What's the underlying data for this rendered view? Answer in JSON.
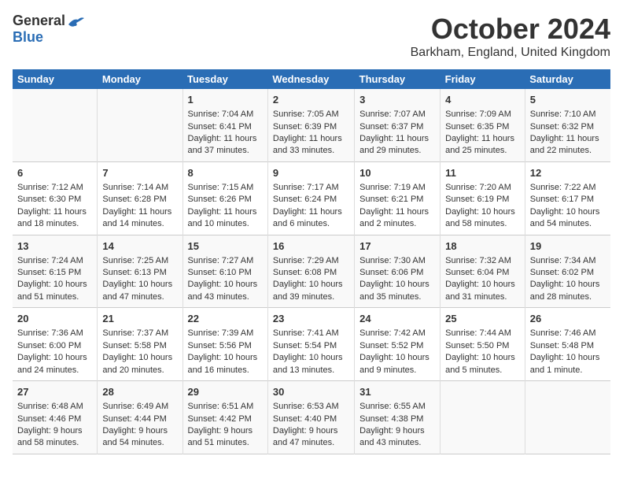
{
  "logo": {
    "general": "General",
    "blue": "Blue"
  },
  "title": {
    "month": "October 2024",
    "location": "Barkham, England, United Kingdom"
  },
  "days_of_week": [
    "Sunday",
    "Monday",
    "Tuesday",
    "Wednesday",
    "Thursday",
    "Friday",
    "Saturday"
  ],
  "weeks": [
    [
      {
        "day": "",
        "content": ""
      },
      {
        "day": "",
        "content": ""
      },
      {
        "day": "1",
        "content": "Sunrise: 7:04 AM\nSunset: 6:41 PM\nDaylight: 11 hours and 37 minutes."
      },
      {
        "day": "2",
        "content": "Sunrise: 7:05 AM\nSunset: 6:39 PM\nDaylight: 11 hours and 33 minutes."
      },
      {
        "day": "3",
        "content": "Sunrise: 7:07 AM\nSunset: 6:37 PM\nDaylight: 11 hours and 29 minutes."
      },
      {
        "day": "4",
        "content": "Sunrise: 7:09 AM\nSunset: 6:35 PM\nDaylight: 11 hours and 25 minutes."
      },
      {
        "day": "5",
        "content": "Sunrise: 7:10 AM\nSunset: 6:32 PM\nDaylight: 11 hours and 22 minutes."
      }
    ],
    [
      {
        "day": "6",
        "content": "Sunrise: 7:12 AM\nSunset: 6:30 PM\nDaylight: 11 hours and 18 minutes."
      },
      {
        "day": "7",
        "content": "Sunrise: 7:14 AM\nSunset: 6:28 PM\nDaylight: 11 hours and 14 minutes."
      },
      {
        "day": "8",
        "content": "Sunrise: 7:15 AM\nSunset: 6:26 PM\nDaylight: 11 hours and 10 minutes."
      },
      {
        "day": "9",
        "content": "Sunrise: 7:17 AM\nSunset: 6:24 PM\nDaylight: 11 hours and 6 minutes."
      },
      {
        "day": "10",
        "content": "Sunrise: 7:19 AM\nSunset: 6:21 PM\nDaylight: 11 hours and 2 minutes."
      },
      {
        "day": "11",
        "content": "Sunrise: 7:20 AM\nSunset: 6:19 PM\nDaylight: 10 hours and 58 minutes."
      },
      {
        "day": "12",
        "content": "Sunrise: 7:22 AM\nSunset: 6:17 PM\nDaylight: 10 hours and 54 minutes."
      }
    ],
    [
      {
        "day": "13",
        "content": "Sunrise: 7:24 AM\nSunset: 6:15 PM\nDaylight: 10 hours and 51 minutes."
      },
      {
        "day": "14",
        "content": "Sunrise: 7:25 AM\nSunset: 6:13 PM\nDaylight: 10 hours and 47 minutes."
      },
      {
        "day": "15",
        "content": "Sunrise: 7:27 AM\nSunset: 6:10 PM\nDaylight: 10 hours and 43 minutes."
      },
      {
        "day": "16",
        "content": "Sunrise: 7:29 AM\nSunset: 6:08 PM\nDaylight: 10 hours and 39 minutes."
      },
      {
        "day": "17",
        "content": "Sunrise: 7:30 AM\nSunset: 6:06 PM\nDaylight: 10 hours and 35 minutes."
      },
      {
        "day": "18",
        "content": "Sunrise: 7:32 AM\nSunset: 6:04 PM\nDaylight: 10 hours and 31 minutes."
      },
      {
        "day": "19",
        "content": "Sunrise: 7:34 AM\nSunset: 6:02 PM\nDaylight: 10 hours and 28 minutes."
      }
    ],
    [
      {
        "day": "20",
        "content": "Sunrise: 7:36 AM\nSunset: 6:00 PM\nDaylight: 10 hours and 24 minutes."
      },
      {
        "day": "21",
        "content": "Sunrise: 7:37 AM\nSunset: 5:58 PM\nDaylight: 10 hours and 20 minutes."
      },
      {
        "day": "22",
        "content": "Sunrise: 7:39 AM\nSunset: 5:56 PM\nDaylight: 10 hours and 16 minutes."
      },
      {
        "day": "23",
        "content": "Sunrise: 7:41 AM\nSunset: 5:54 PM\nDaylight: 10 hours and 13 minutes."
      },
      {
        "day": "24",
        "content": "Sunrise: 7:42 AM\nSunset: 5:52 PM\nDaylight: 10 hours and 9 minutes."
      },
      {
        "day": "25",
        "content": "Sunrise: 7:44 AM\nSunset: 5:50 PM\nDaylight: 10 hours and 5 minutes."
      },
      {
        "day": "26",
        "content": "Sunrise: 7:46 AM\nSunset: 5:48 PM\nDaylight: 10 hours and 1 minute."
      }
    ],
    [
      {
        "day": "27",
        "content": "Sunrise: 6:48 AM\nSunset: 4:46 PM\nDaylight: 9 hours and 58 minutes."
      },
      {
        "day": "28",
        "content": "Sunrise: 6:49 AM\nSunset: 4:44 PM\nDaylight: 9 hours and 54 minutes."
      },
      {
        "day": "29",
        "content": "Sunrise: 6:51 AM\nSunset: 4:42 PM\nDaylight: 9 hours and 51 minutes."
      },
      {
        "day": "30",
        "content": "Sunrise: 6:53 AM\nSunset: 4:40 PM\nDaylight: 9 hours and 47 minutes."
      },
      {
        "day": "31",
        "content": "Sunrise: 6:55 AM\nSunset: 4:38 PM\nDaylight: 9 hours and 43 minutes."
      },
      {
        "day": "",
        "content": ""
      },
      {
        "day": "",
        "content": ""
      }
    ]
  ]
}
